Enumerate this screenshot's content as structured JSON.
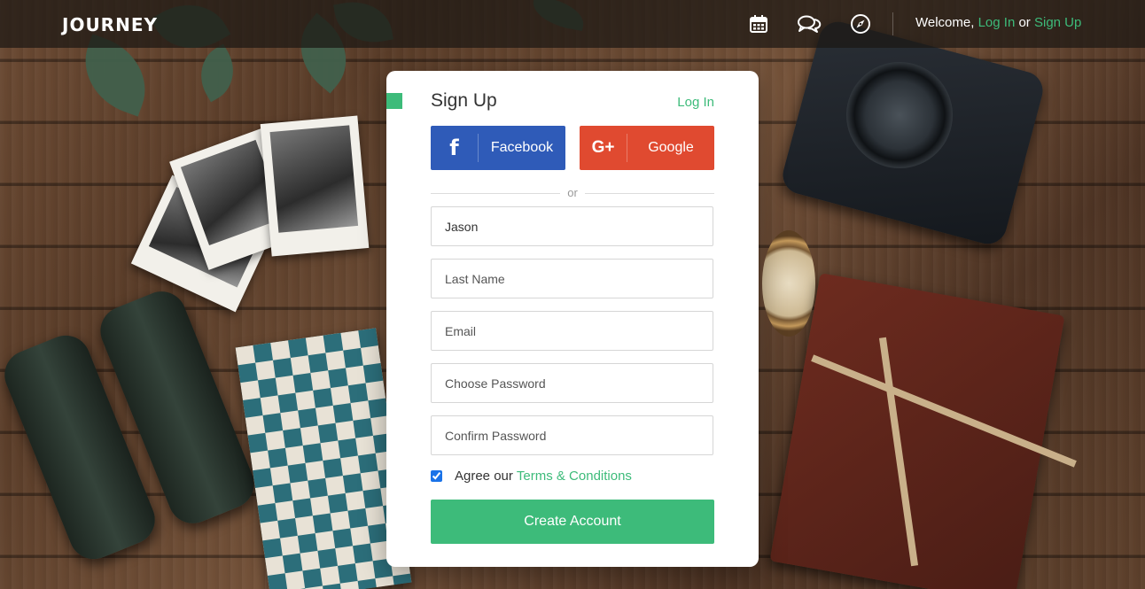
{
  "navbar": {
    "brand": "JOURNEY",
    "icons": [
      "calendar-icon",
      "chat-icon",
      "compass-icon"
    ],
    "welcome_prefix": "Welcome, ",
    "login_link": "Log In",
    "or_text": " or ",
    "signup_link": "Sign Up"
  },
  "card": {
    "title": "Sign Up",
    "login_link": "Log In",
    "facebook_label": "Facebook",
    "facebook_icon": "f",
    "google_label": "Google",
    "google_icon": "G+",
    "divider_text": "or",
    "fields": {
      "first_name_value": "Jason",
      "last_name_placeholder": "Last Name",
      "email_placeholder": "Email",
      "password_placeholder": "Choose Password",
      "confirm_password_placeholder": "Confirm Password"
    },
    "agree_prefix": "Agree our",
    "terms_link": "Terms & Conditions",
    "agree_checked": true,
    "submit_label": "Create Account"
  },
  "colors": {
    "accent": "#3dbb7a",
    "facebook": "#2f5bb8",
    "google": "#e04a30"
  }
}
